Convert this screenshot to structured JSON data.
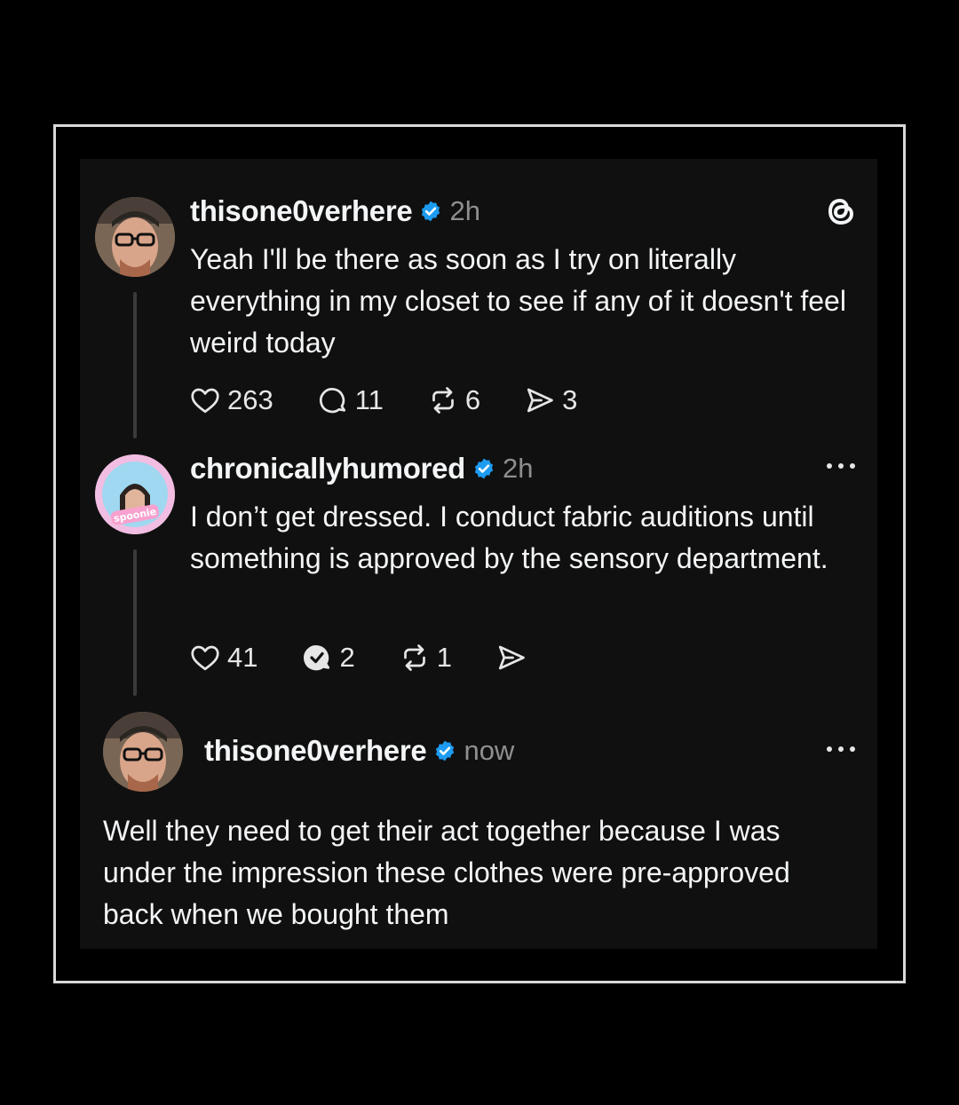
{
  "colors": {
    "background": "#000000",
    "card": "#101010",
    "text": "#f3f5f7",
    "muted": "#8f8f8f",
    "verified": "#1d9bf0",
    "frame_border": "#d9d9d9"
  },
  "app_logo": "threads-logo-icon",
  "posts": [
    {
      "username": "thisone0verhere",
      "verified": true,
      "time": "2h",
      "text": "Yeah I'll be there as soon as I try on literally everything in my closet to see if any of it doesn't feel weird today",
      "likes": "263",
      "replies": "11",
      "reposts": "6",
      "shares": "3"
    },
    {
      "username": "chronicallyhumored",
      "verified": true,
      "time": "2h",
      "text": "I don’t get dressed. I conduct fabric auditions until something is approved by the sensory department.",
      "likes": "41",
      "replies": "2",
      "reposts": "1"
    },
    {
      "username": "thisone0verhere",
      "verified": true,
      "time": "now",
      "text": "Well they need to get their act together because I was under the impression these clothes were pre-approved back when we bought them"
    }
  ]
}
